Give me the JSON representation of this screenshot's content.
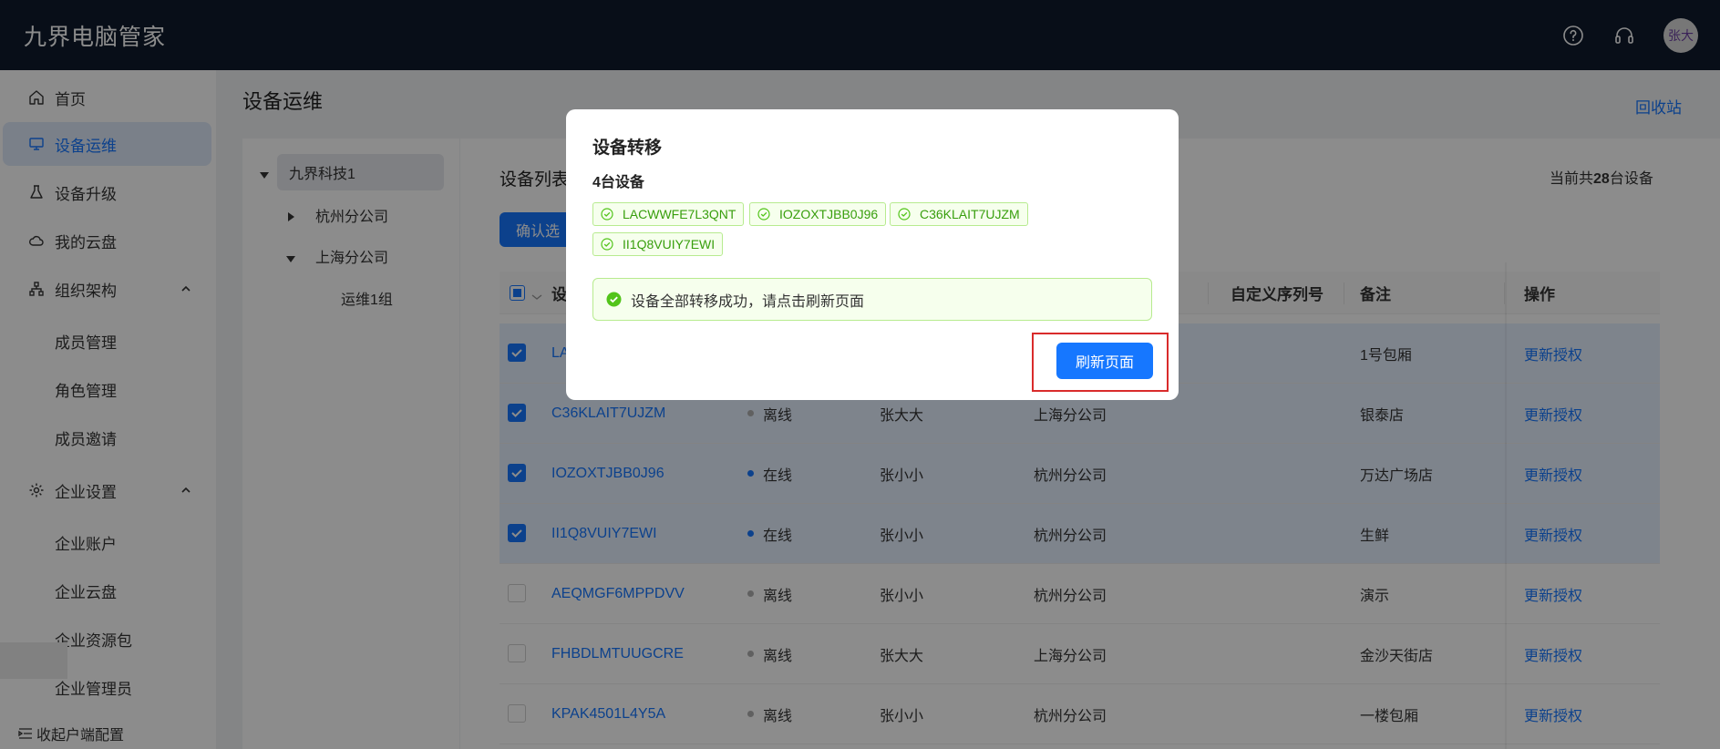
{
  "header": {
    "app_title": "九界电脑管家",
    "avatar_text": "张大"
  },
  "sidebar": {
    "items": [
      {
        "label": "首页",
        "icon": "home-icon"
      },
      {
        "label": "设备运维",
        "icon": "monitor-icon",
        "active": true
      },
      {
        "label": "设备升级",
        "icon": "flask-icon"
      },
      {
        "label": "我的云盘",
        "icon": "cloud-icon"
      },
      {
        "label": "组织架构",
        "icon": "org-icon",
        "expanded": true
      }
    ],
    "org_children": [
      "成员管理",
      "角色管理",
      "成员邀请"
    ],
    "settings": {
      "label": "企业设置",
      "icon": "gear-icon",
      "expanded": true
    },
    "settings_children": [
      "企业账户",
      "企业云盘",
      "企业资源包",
      "企业管理员"
    ],
    "collapse_label": "收起户端配置"
  },
  "page": {
    "title": "设备运维",
    "recycle_label": "回收站"
  },
  "tree": {
    "root": "九界科技1",
    "children": [
      "杭州分公司",
      "上海分公司"
    ],
    "grandchildren": [
      "运维1组"
    ]
  },
  "list": {
    "title": "设备列表",
    "count_prefix": "当前共",
    "count_value": "28",
    "count_suffix": "台设备",
    "confirm_btn": "确认选",
    "columns": {
      "device": "设",
      "custom_serial": "自定义序列号",
      "remark": "备注",
      "action": "操作"
    },
    "rows": [
      {
        "selected": true,
        "id": "LA",
        "status": "",
        "status_color": "",
        "user": "",
        "branch": "",
        "remark": "1号包厢",
        "action": "更新授权"
      },
      {
        "selected": true,
        "id": "C36KLAIT7UJZM",
        "status": "离线",
        "status_color": "#b0b0b0",
        "user": "张大大",
        "branch": "上海分公司",
        "remark": "银泰店",
        "action": "更新授权"
      },
      {
        "selected": true,
        "id": "IOZOXTJBB0J96",
        "status": "在线",
        "status_color": "#1677ff",
        "user": "张小小",
        "branch": "杭州分公司",
        "remark": "万达广场店",
        "action": "更新授权"
      },
      {
        "selected": true,
        "id": "II1Q8VUIY7EWI",
        "status": "在线",
        "status_color": "#1677ff",
        "user": "张小小",
        "branch": "杭州分公司",
        "remark": "生鲜",
        "action": "更新授权"
      },
      {
        "selected": false,
        "id": "AEQMGF6MPPDVV",
        "status": "离线",
        "status_color": "#b0b0b0",
        "user": "张小小",
        "branch": "杭州分公司",
        "remark": "演示",
        "action": "更新授权"
      },
      {
        "selected": false,
        "id": "FHBDLMTUUGCRE",
        "status": "离线",
        "status_color": "#b0b0b0",
        "user": "张大大",
        "branch": "上海分公司",
        "remark": "金沙天街店",
        "action": "更新授权"
      },
      {
        "selected": false,
        "id": "KPAK4501L4Y5A",
        "status": "离线",
        "status_color": "#b0b0b0",
        "user": "张小小",
        "branch": "杭州分公司",
        "remark": "一楼包厢",
        "action": "更新授权"
      }
    ]
  },
  "modal": {
    "title": "设备转移",
    "subtitle": "4台设备",
    "tags": [
      "LACWWFE7L3QNT",
      "IOZOXTJBB0J96",
      "C36KLAIT7UJZM",
      "II1Q8VUIY7EWI"
    ],
    "alert": "设备全部转移成功，请点击刷新页面",
    "refresh_btn": "刷新页面"
  },
  "colors": {
    "primary": "#1677ff",
    "header_bg": "#0f1b2d",
    "success": "#52c41a",
    "highlight": "#d92b2b"
  }
}
